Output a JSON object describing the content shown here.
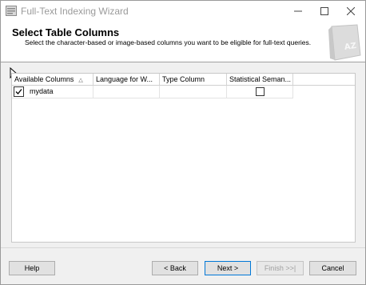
{
  "window": {
    "title": "Full-Text Indexing Wizard"
  },
  "header": {
    "title": "Select Table Columns",
    "subtitle": "Select the character-based or image-based columns you want to be eligible for full-text queries.",
    "book_badge": "AZ"
  },
  "grid": {
    "columns": [
      "Available Columns",
      "Language for W...",
      "Type Column",
      "Statistical Seman..."
    ],
    "sort_glyph": "△",
    "rows": [
      {
        "column": "mydata",
        "selected": true,
        "language": "",
        "type_column": "",
        "statistical_semantics": false
      }
    ]
  },
  "buttons": {
    "help": "Help",
    "back": "< Back",
    "next": "Next >",
    "finish": "Finish >>|",
    "cancel": "Cancel"
  },
  "colors": {
    "accent_border": "#0078d7",
    "disabled_text": "#a0a0a0"
  }
}
